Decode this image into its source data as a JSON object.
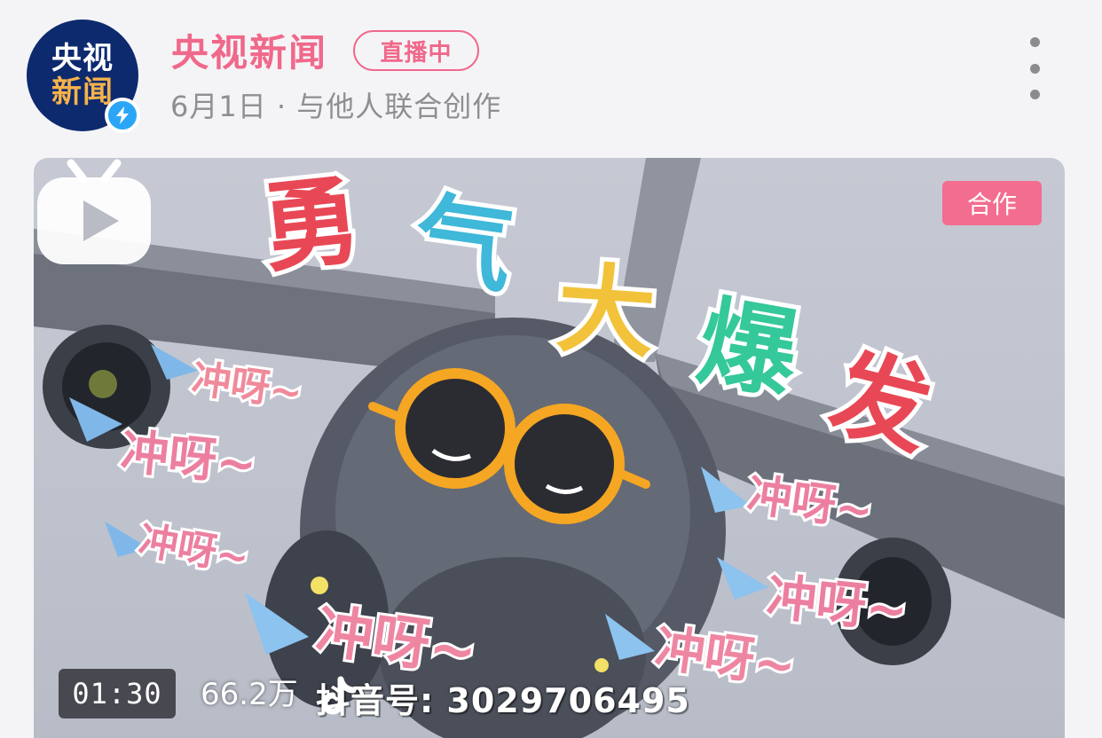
{
  "post": {
    "avatar_line1": "央视",
    "avatar_line2": "新闻",
    "author": "央视新闻",
    "live_badge": "直播中",
    "meta": "6月1日 · 与他人联合创作"
  },
  "media": {
    "coop_badge": "合作",
    "title_chars": [
      "勇",
      "气",
      "大",
      "爆",
      "发"
    ],
    "cheer_text": "冲呀~",
    "duration": "01:30",
    "stats": "66.2万",
    "watermark": "抖音号: 3029706495"
  },
  "colors": {
    "accent_pink": "#f0688a",
    "badge_pink": "#f26d8f",
    "avatar_navy": "#0d2a6e",
    "verified_blue": "#2ba6f6",
    "meta_gray": "#8e8e93"
  },
  "icons": [
    "verified-icon",
    "more-icon",
    "douyin-logo-icon",
    "tv-play-icon"
  ]
}
